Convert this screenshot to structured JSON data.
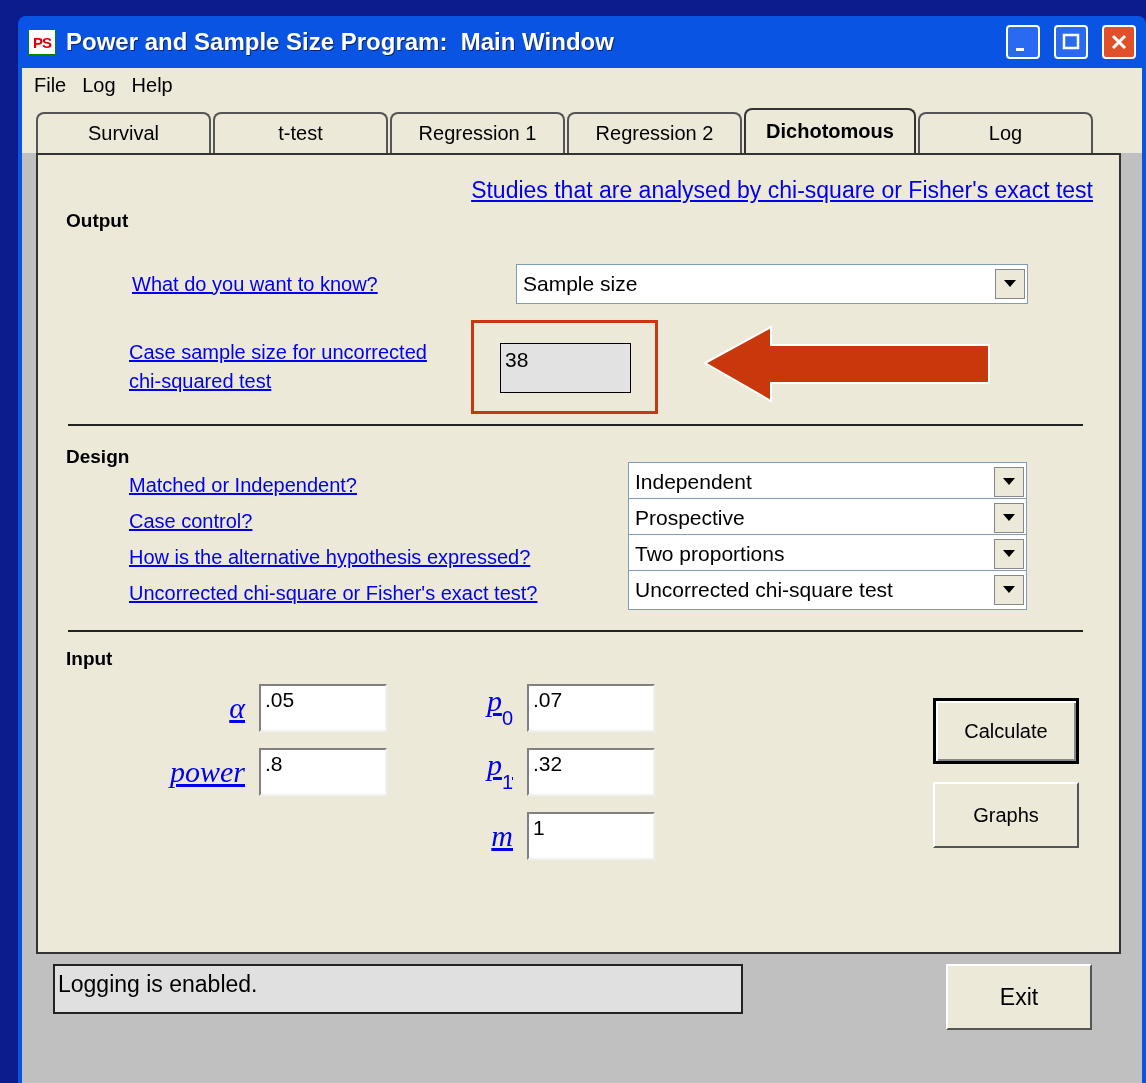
{
  "window": {
    "logo": "PS",
    "title": "Power and Sample Size Program:  Main Window"
  },
  "menu": [
    "File",
    "Log",
    "Help"
  ],
  "tabs": [
    {
      "label": "Survival",
      "selected": false
    },
    {
      "label": "t-test",
      "selected": false
    },
    {
      "label": "Regression 1",
      "selected": false
    },
    {
      "label": "Regression 2",
      "selected": false
    },
    {
      "label": "Dichotomous",
      "selected": true
    },
    {
      "label": "Log",
      "selected": false
    }
  ],
  "panel": {
    "heading_link": "Studies that are analysed by chi-square or Fisher's exact test",
    "output": {
      "title": "Output",
      "question": {
        "label": "What do you want to know?",
        "value": "Sample size"
      },
      "result": {
        "label": "Case sample size for uncorrected chi-squared test",
        "value": "38",
        "highlighted": true
      }
    },
    "design": {
      "title": "Design",
      "rows": [
        {
          "label": "Matched or Independent?",
          "value": "Independent"
        },
        {
          "label": "Case control?",
          "value": "Prospective"
        },
        {
          "label": "How is the alternative hypothesis expressed?",
          "value": "Two proportions"
        },
        {
          "label": "Uncorrected chi-square or Fisher's exact test?",
          "value": "Uncorrected chi-square test"
        }
      ]
    },
    "input": {
      "title": "Input",
      "fields": [
        {
          "label": "α",
          "value": ".05"
        },
        {
          "label": "power",
          "value": ".8"
        },
        {
          "label": "p$_{0}$",
          "value": ".07"
        },
        {
          "label": "p$_{1}$",
          "value": ".32"
        },
        {
          "label": "m",
          "value": "1"
        }
      ]
    },
    "buttons": [
      {
        "label": "Calculate",
        "focused": true
      },
      {
        "label": "Graphs",
        "focused": false
      }
    ]
  },
  "status_bar": {
    "text": "Logging is enabled."
  },
  "exit_button": "Exit"
}
